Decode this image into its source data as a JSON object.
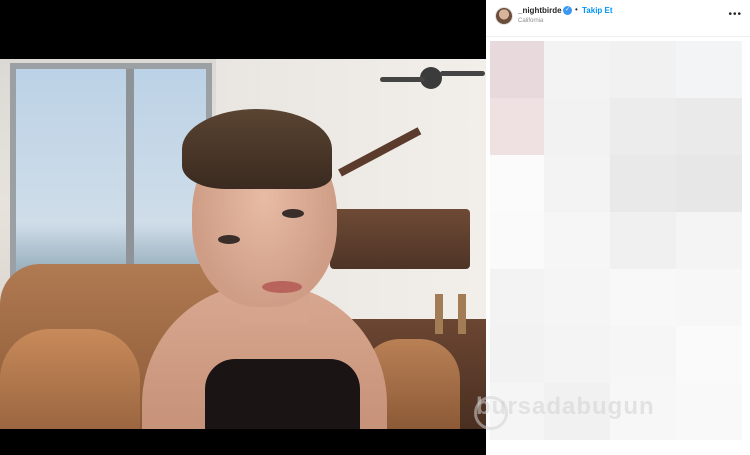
{
  "post": {
    "username": "_nightbirde",
    "verified_glyph": "✓",
    "separator": "•",
    "follow_label": "Takip Et",
    "location": "California",
    "more_label": "•••"
  },
  "watermark": {
    "text": "bursadabugun"
  },
  "icons": {
    "verified": "verified-badge-icon",
    "more": "more-options-icon"
  },
  "colors": {
    "follow_link": "#0095f6",
    "verified": "#3897f0",
    "background": "#000000",
    "panel": "#ffffff"
  },
  "mosaic_tiles": [
    "#e8d9dc",
    "#f4f3f3",
    "#f1f1f1",
    "#f3f4f5",
    "#efe1e2",
    "#f2f2f2",
    "#ececec",
    "#eaeaea",
    "#fbfbfb",
    "#f3f3f3",
    "#e9e9e9",
    "#e7e7e7",
    "#fafafa",
    "#f6f6f6",
    "#f0f0f0",
    "#f4f4f4",
    "#f3f3f3",
    "#f5f5f5",
    "#f8f8f8",
    "#f7f7f7",
    "#f2f2f2",
    "#f4f4f4",
    "#f6f6f6",
    "#fafafa",
    "#f5f5f5",
    "#f1f1f1",
    "#f7f7f7",
    "#f9f9f9"
  ]
}
